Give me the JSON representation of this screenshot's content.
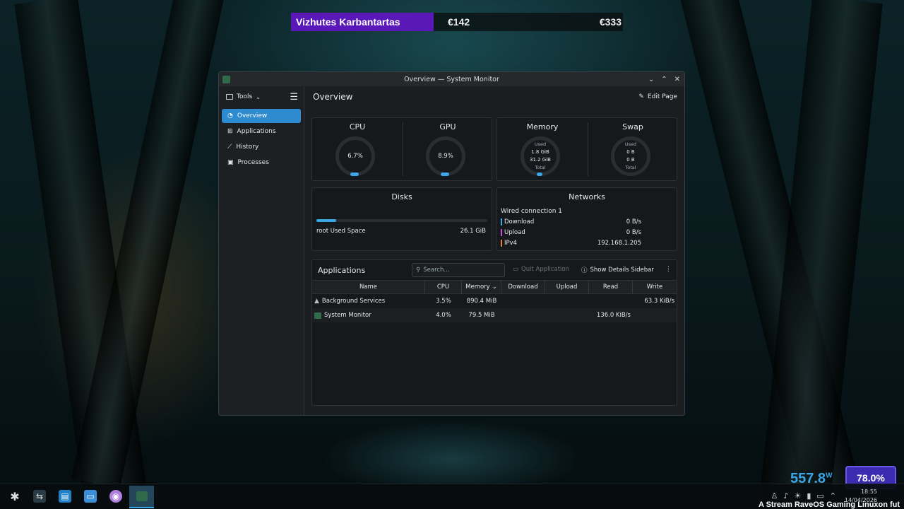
{
  "overlay": {
    "name": "Vizhutes Karbantartas",
    "value_a": "€142",
    "value_b": "€333"
  },
  "window": {
    "title": "Overview — System Monitor",
    "controls": [
      "⌄",
      "⌃",
      "✕"
    ]
  },
  "sidebar": {
    "tools_label": "Tools",
    "items": [
      {
        "label": "Overview"
      },
      {
        "label": "Applications"
      },
      {
        "label": "History"
      },
      {
        "label": "Processes"
      }
    ]
  },
  "page": {
    "title": "Overview",
    "edit_label": "Edit Page"
  },
  "gauges": {
    "cpu": {
      "title": "CPU",
      "value": "6.7%"
    },
    "gpu": {
      "title": "GPU",
      "value": "8.9%"
    },
    "memory": {
      "title": "Memory",
      "used_label": "Used",
      "used": "1.8 GiB",
      "total": "31.2 GiB",
      "total_label": "Total"
    },
    "swap": {
      "title": "Swap",
      "used_label": "Used",
      "used": "0 B",
      "total": "0 B",
      "total_label": "Total"
    }
  },
  "disks": {
    "title": "Disks",
    "label": "root Used Space",
    "value": "26.1 GiB"
  },
  "networks": {
    "title": "Networks",
    "connection": "Wired connection 1",
    "rows": [
      {
        "label": "Download",
        "value": "0 B/s",
        "color": "#3aa6e6"
      },
      {
        "label": "Upload",
        "value": "0 B/s",
        "color": "#c84fd8"
      },
      {
        "label": "IPv4",
        "value": "192.168.1.205",
        "color": "#e0803a"
      }
    ]
  },
  "applications": {
    "title": "Applications",
    "search_placeholder": "Search...",
    "quit_label": "Quit Application",
    "details_label": "Show Details Sidebar",
    "columns": [
      "Name",
      "CPU",
      "Memory",
      "Download",
      "Upload",
      "Read",
      "Write"
    ],
    "rows": [
      {
        "name": "Background Services",
        "cpu": "3.5%",
        "memory": "890.4 MiB",
        "download": "",
        "upload": "",
        "read": "",
        "write": "63.3 KiB/s"
      },
      {
        "name": "System Monitor",
        "cpu": "4.0%",
        "memory": "79.5 MiB",
        "download": "",
        "upload": "",
        "read": "136.0 KiB/s",
        "write": ""
      }
    ]
  },
  "hud": {
    "power": "557.8",
    "power_unit": "W",
    "battery": "78.0%",
    "time": "18:55",
    "date": "14/04/2026",
    "ticker": "A Stream RaveOS Gaming Linuxon fut"
  }
}
